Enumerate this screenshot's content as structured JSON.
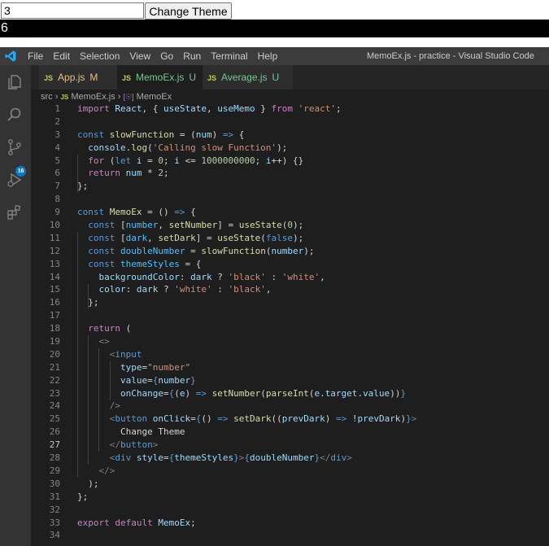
{
  "demo": {
    "input_value": "3",
    "button_label": "Change Theme",
    "output_text": "6"
  },
  "vscode": {
    "menu": [
      "File",
      "Edit",
      "Selection",
      "View",
      "Go",
      "Run",
      "Terminal",
      "Help"
    ],
    "window_title": "MemoEx.js - practice - Visual Studio Code",
    "badge_count": "16",
    "tabs": [
      {
        "icon_text": "JS",
        "label": "App.js",
        "suffix": "M"
      },
      {
        "icon_text": "JS",
        "label": "MemoEx.js",
        "suffix": "U"
      },
      {
        "icon_text": "JS",
        "label": "Average.js",
        "suffix": "U"
      }
    ],
    "breadcrumb": {
      "folder": "src",
      "file_icon_text": "JS",
      "file": "MemoEx.js",
      "symbol_icon_text": "[☉]",
      "symbol": "MemoEx"
    },
    "colors": {
      "accent": "#007acc",
      "editor_bg": "#1e1e1e",
      "activity_bar": "#333333",
      "title_bar": "#3c3c3c"
    },
    "current_line": 27,
    "code_lines": [
      [
        [
          "kw",
          "import "
        ],
        [
          "vr",
          "React"
        ],
        [
          "tx",
          ", { "
        ],
        [
          "vr",
          "useState"
        ],
        [
          "tx",
          ", "
        ],
        [
          "vr",
          "useMemo"
        ],
        [
          "tx",
          " } "
        ],
        [
          "kw",
          "from "
        ],
        [
          "str",
          "'react'"
        ],
        [
          "tx",
          ";"
        ]
      ],
      [],
      [
        [
          "st",
          "const "
        ],
        [
          "fn",
          "slowFunction"
        ],
        [
          "tx",
          " = ("
        ],
        [
          "vr",
          "num"
        ],
        [
          "tx",
          ") "
        ],
        [
          "st",
          "=>"
        ],
        [
          "tx",
          " {"
        ]
      ],
      [
        [
          "tx",
          "  "
        ],
        [
          "vr",
          "console"
        ],
        [
          "tx",
          "."
        ],
        [
          "fn",
          "log"
        ],
        [
          "tx",
          "("
        ],
        [
          "str",
          "'Calling slow Function'"
        ],
        [
          "tx",
          ");"
        ]
      ],
      [
        [
          "tx",
          "  "
        ],
        [
          "kw",
          "for"
        ],
        [
          "tx",
          " ("
        ],
        [
          "st",
          "let "
        ],
        [
          "vr",
          "i"
        ],
        [
          "tx",
          " = "
        ],
        [
          "num",
          "0"
        ],
        [
          "tx",
          "; "
        ],
        [
          "vr",
          "i"
        ],
        [
          "tx",
          " <= "
        ],
        [
          "num",
          "1000000000"
        ],
        [
          "tx",
          "; "
        ],
        [
          "vr",
          "i"
        ],
        [
          "tx",
          "++) {}"
        ]
      ],
      [
        [
          "tx",
          "  "
        ],
        [
          "kw",
          "return "
        ],
        [
          "vr",
          "num"
        ],
        [
          "tx",
          " * "
        ],
        [
          "num",
          "2"
        ],
        [
          "tx",
          ";"
        ]
      ],
      [
        [
          "tx",
          "};"
        ]
      ],
      [],
      [
        [
          "st",
          "const "
        ],
        [
          "fn",
          "MemoEx"
        ],
        [
          "tx",
          " = () "
        ],
        [
          "st",
          "=>"
        ],
        [
          "tx",
          " {"
        ]
      ],
      [
        [
          "tx",
          "  "
        ],
        [
          "st",
          "const "
        ],
        [
          "tx",
          "["
        ],
        [
          "cn",
          "number"
        ],
        [
          "tx",
          ", "
        ],
        [
          "fn",
          "setNumber"
        ],
        [
          "tx",
          "] = "
        ],
        [
          "fn",
          "useState"
        ],
        [
          "tx",
          "("
        ],
        [
          "num",
          "0"
        ],
        [
          "tx",
          ");"
        ]
      ],
      [
        [
          "tx",
          "  "
        ],
        [
          "st",
          "const "
        ],
        [
          "tx",
          "["
        ],
        [
          "cn",
          "dark"
        ],
        [
          "tx",
          ", "
        ],
        [
          "fn",
          "setDark"
        ],
        [
          "tx",
          "] = "
        ],
        [
          "fn",
          "useState"
        ],
        [
          "tx",
          "("
        ],
        [
          "st",
          "false"
        ],
        [
          "tx",
          ");"
        ]
      ],
      [
        [
          "tx",
          "  "
        ],
        [
          "st",
          "const "
        ],
        [
          "cn",
          "doubleNumber"
        ],
        [
          "tx",
          " = "
        ],
        [
          "fn",
          "slowFunction"
        ],
        [
          "tx",
          "("
        ],
        [
          "vr",
          "number"
        ],
        [
          "tx",
          ");"
        ]
      ],
      [
        [
          "tx",
          "  "
        ],
        [
          "st",
          "const "
        ],
        [
          "cn",
          "themeStyles"
        ],
        [
          "tx",
          " = {"
        ]
      ],
      [
        [
          "tx",
          "    "
        ],
        [
          "vr",
          "backgroundColor"
        ],
        [
          "tx",
          ": "
        ],
        [
          "vr",
          "dark"
        ],
        [
          "tx",
          " ? "
        ],
        [
          "str",
          "'black'"
        ],
        [
          "tx",
          " : "
        ],
        [
          "str",
          "'white'"
        ],
        [
          "tx",
          ","
        ]
      ],
      [
        [
          "tx",
          "    "
        ],
        [
          "vr",
          "color"
        ],
        [
          "tx",
          ": "
        ],
        [
          "vr",
          "dark"
        ],
        [
          "tx",
          " ? "
        ],
        [
          "str",
          "'white'"
        ],
        [
          "tx",
          " : "
        ],
        [
          "str",
          "'black'"
        ],
        [
          "tx",
          ","
        ]
      ],
      [
        [
          "tx",
          "  };"
        ]
      ],
      [],
      [
        [
          "tx",
          "  "
        ],
        [
          "kw",
          "return"
        ],
        [
          "tx",
          " ("
        ]
      ],
      [
        [
          "tx",
          "    "
        ],
        [
          "br",
          "<>"
        ]
      ],
      [
        [
          "tx",
          "      "
        ],
        [
          "br",
          "<"
        ],
        [
          "tg",
          "input"
        ]
      ],
      [
        [
          "tx",
          "        "
        ],
        [
          "at",
          "type"
        ],
        [
          "tx",
          "="
        ],
        [
          "str",
          "\"number\""
        ]
      ],
      [
        [
          "tx",
          "        "
        ],
        [
          "at",
          "value"
        ],
        [
          "tx",
          "="
        ],
        [
          "st",
          "{"
        ],
        [
          "vr",
          "number"
        ],
        [
          "st",
          "}"
        ]
      ],
      [
        [
          "tx",
          "        "
        ],
        [
          "at",
          "onChange"
        ],
        [
          "tx",
          "="
        ],
        [
          "st",
          "{"
        ],
        [
          "tx",
          "("
        ],
        [
          "vr",
          "e"
        ],
        [
          "tx",
          ") "
        ],
        [
          "st",
          "=>"
        ],
        [
          "tx",
          " "
        ],
        [
          "fn",
          "setNumber"
        ],
        [
          "tx",
          "("
        ],
        [
          "fn",
          "parseInt"
        ],
        [
          "tx",
          "("
        ],
        [
          "vr",
          "e"
        ],
        [
          "tx",
          "."
        ],
        [
          "vr",
          "target"
        ],
        [
          "tx",
          "."
        ],
        [
          "vr",
          "value"
        ],
        [
          "tx",
          "))"
        ],
        [
          "st",
          "}"
        ]
      ],
      [
        [
          "tx",
          "      "
        ],
        [
          "br",
          "/>"
        ]
      ],
      [
        [
          "tx",
          "      "
        ],
        [
          "br",
          "<"
        ],
        [
          "tg",
          "button"
        ],
        [
          "tx",
          " "
        ],
        [
          "at",
          "onClick"
        ],
        [
          "tx",
          "="
        ],
        [
          "st",
          "{"
        ],
        [
          "tx",
          "() "
        ],
        [
          "st",
          "=>"
        ],
        [
          "tx",
          " "
        ],
        [
          "fn",
          "setDark"
        ],
        [
          "tx",
          "(("
        ],
        [
          "vr",
          "prevDark"
        ],
        [
          "tx",
          ") "
        ],
        [
          "st",
          "=>"
        ],
        [
          "tx",
          " !"
        ],
        [
          "vr",
          "prevDark"
        ],
        [
          "tx",
          ")"
        ],
        [
          "st",
          "}"
        ],
        [
          "br",
          ">"
        ]
      ],
      [
        [
          "tx",
          "        Change Theme"
        ]
      ],
      [
        [
          "tx",
          "      "
        ],
        [
          "br",
          "</"
        ],
        [
          "tg",
          "button"
        ],
        [
          "br",
          ">"
        ]
      ],
      [
        [
          "tx",
          "      "
        ],
        [
          "br",
          "<"
        ],
        [
          "tg",
          "div"
        ],
        [
          "tx",
          " "
        ],
        [
          "at",
          "style"
        ],
        [
          "tx",
          "="
        ],
        [
          "st",
          "{"
        ],
        [
          "vr",
          "themeStyles"
        ],
        [
          "st",
          "}"
        ],
        [
          "br",
          ">"
        ],
        [
          "st",
          "{"
        ],
        [
          "vr",
          "doubleNumber"
        ],
        [
          "st",
          "}"
        ],
        [
          "br",
          "</"
        ],
        [
          "tg",
          "div"
        ],
        [
          "br",
          ">"
        ]
      ],
      [
        [
          "tx",
          "    "
        ],
        [
          "br",
          "</>"
        ]
      ],
      [
        [
          "tx",
          "  );"
        ]
      ],
      [
        [
          "tx",
          "};"
        ]
      ],
      [],
      [
        [
          "kw",
          "export "
        ],
        [
          "kw",
          "default "
        ],
        [
          "vr",
          "MemoEx"
        ],
        [
          "tx",
          ";"
        ]
      ],
      []
    ]
  }
}
